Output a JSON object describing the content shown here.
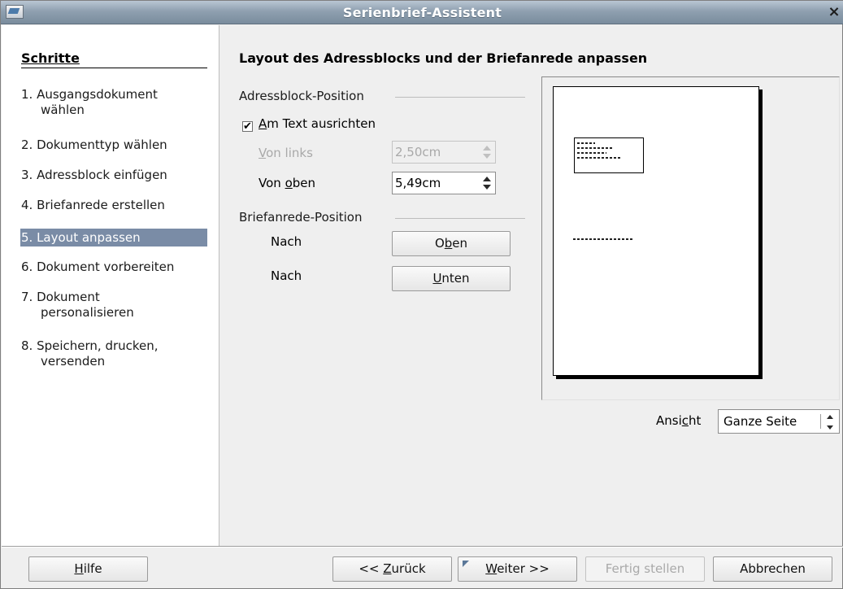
{
  "window": {
    "title": "Serienbrief-Assistent",
    "close_glyph": "×"
  },
  "steps": {
    "heading": "Schritte",
    "items": [
      {
        "num": "1.",
        "label": "Ausgangsdokument wählen",
        "lines": [
          "1. Ausgangsdokument",
          "wählen"
        ]
      },
      {
        "num": "2.",
        "label": "Dokumenttyp wählen",
        "lines": [
          "2. Dokumenttyp wählen"
        ]
      },
      {
        "num": "3.",
        "label": "Adressblock einfügen",
        "lines": [
          "3. Adressblock einfügen"
        ]
      },
      {
        "num": "4.",
        "label": "Briefanrede erstellen",
        "lines": [
          "4. Briefanrede erstellen"
        ]
      },
      {
        "num": "5.",
        "label": "Layout anpassen",
        "lines": [
          "5. Layout anpassen"
        ],
        "active": true
      },
      {
        "num": "6.",
        "label": "Dokument vorbereiten",
        "lines": [
          "6. Dokument vorbereiten"
        ]
      },
      {
        "num": "7.",
        "label": "Dokument personalisieren",
        "lines": [
          "7. Dokument",
          "personalisieren"
        ]
      },
      {
        "num": "8.",
        "label": "Speichern, drucken, versenden",
        "lines": [
          "8. Speichern, drucken,",
          "versenden"
        ]
      }
    ]
  },
  "main": {
    "title": "Layout des Adressblocks und der Briefanrede anpassen",
    "address_section": {
      "label": "Adressblock-Position",
      "align_checkbox": {
        "checked": true,
        "mnemonic": "A",
        "rest": "m Text ausrichten"
      },
      "from_left": {
        "mnemonic": "V",
        "rest": "on links",
        "value": "2,50cm",
        "enabled": false
      },
      "from_top": {
        "prefix": "Von ",
        "mnemonic": "o",
        "rest": "ben",
        "value": "5,49cm",
        "enabled": true
      }
    },
    "salutation_section": {
      "label": "Briefanrede-Position",
      "up_row": {
        "label": "Nach",
        "button_pre": "O",
        "button_mnemonic": "b",
        "button_post": "en"
      },
      "down_row": {
        "label": "Nach",
        "button_pre": "",
        "button_mnemonic": "U",
        "button_post": "nten"
      }
    },
    "view": {
      "label_pre": "Ansi",
      "label_mnemonic": "c",
      "label_post": "ht",
      "selected": "Ganze Seite"
    }
  },
  "footer": {
    "help": {
      "mnemonic": "H",
      "rest": "ilfe"
    },
    "back": {
      "pre": "<< ",
      "mnemonic": "Z",
      "rest": "urück"
    },
    "next": {
      "mnemonic": "W",
      "rest": "eiter >>"
    },
    "finish": {
      "label": "Fertig stellen",
      "enabled": false
    },
    "cancel": {
      "label": "Abbrechen"
    }
  },
  "colors": {
    "titlebar": "#8fa0b0",
    "active_step": "#7a8ca6"
  },
  "icons": {
    "app": "app-icon",
    "close": "close-icon",
    "check": "checkmark-icon"
  }
}
